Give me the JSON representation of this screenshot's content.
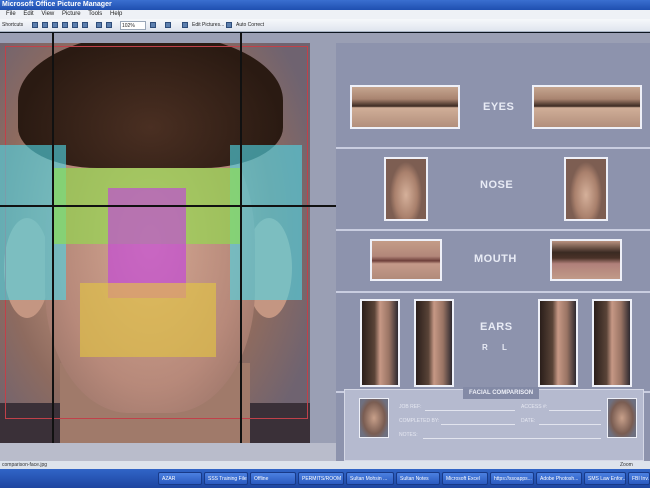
{
  "window": {
    "title": "Microsoft Office Picture Manager"
  },
  "menu": [
    "File",
    "Edit",
    "View",
    "Picture",
    "Tools",
    "Help"
  ],
  "toolbar": {
    "shortcuts_label": "Shortcuts",
    "zoom_value": "102%",
    "edit_pictures_label": "Edit Pictures...",
    "auto_correct_label": "Auto Correct"
  },
  "panel": {
    "features": [
      {
        "label": "EYES"
      },
      {
        "label": "NOSE"
      },
      {
        "label": "MOUTH"
      },
      {
        "label": "EARS"
      }
    ],
    "ears_sub": "R    L",
    "form": {
      "title": "FACIAL COMPARISON",
      "job_label": "JOB REF:",
      "access_label": "ACCESS #:",
      "completed_label": "COMPLETED BY:",
      "date_label": "DATE:",
      "notes_label": "NOTES:"
    }
  },
  "statusbar": {
    "filename": "comparison-face.jpg",
    "zoom_label": "Zoom"
  },
  "taskbar": {
    "items": [
      "AZAR",
      "SSS Training Files",
      "Offline",
      "PERMITS/ROOM",
      "Sultan Mohsin ...",
      "Sultan Notes",
      "Microsoft Excel",
      "https://ssoapps...",
      "Adobe Photosh...",
      "SMS Law Enfor...",
      "FBI Inv..."
    ]
  },
  "colors": {
    "zone_cyan": "#4fd6e6",
    "zone_green": "#8ee04a",
    "zone_magenta": "#c23fe0",
    "zone_yellow": "#e4c640",
    "grid_red": "#c0414a"
  }
}
